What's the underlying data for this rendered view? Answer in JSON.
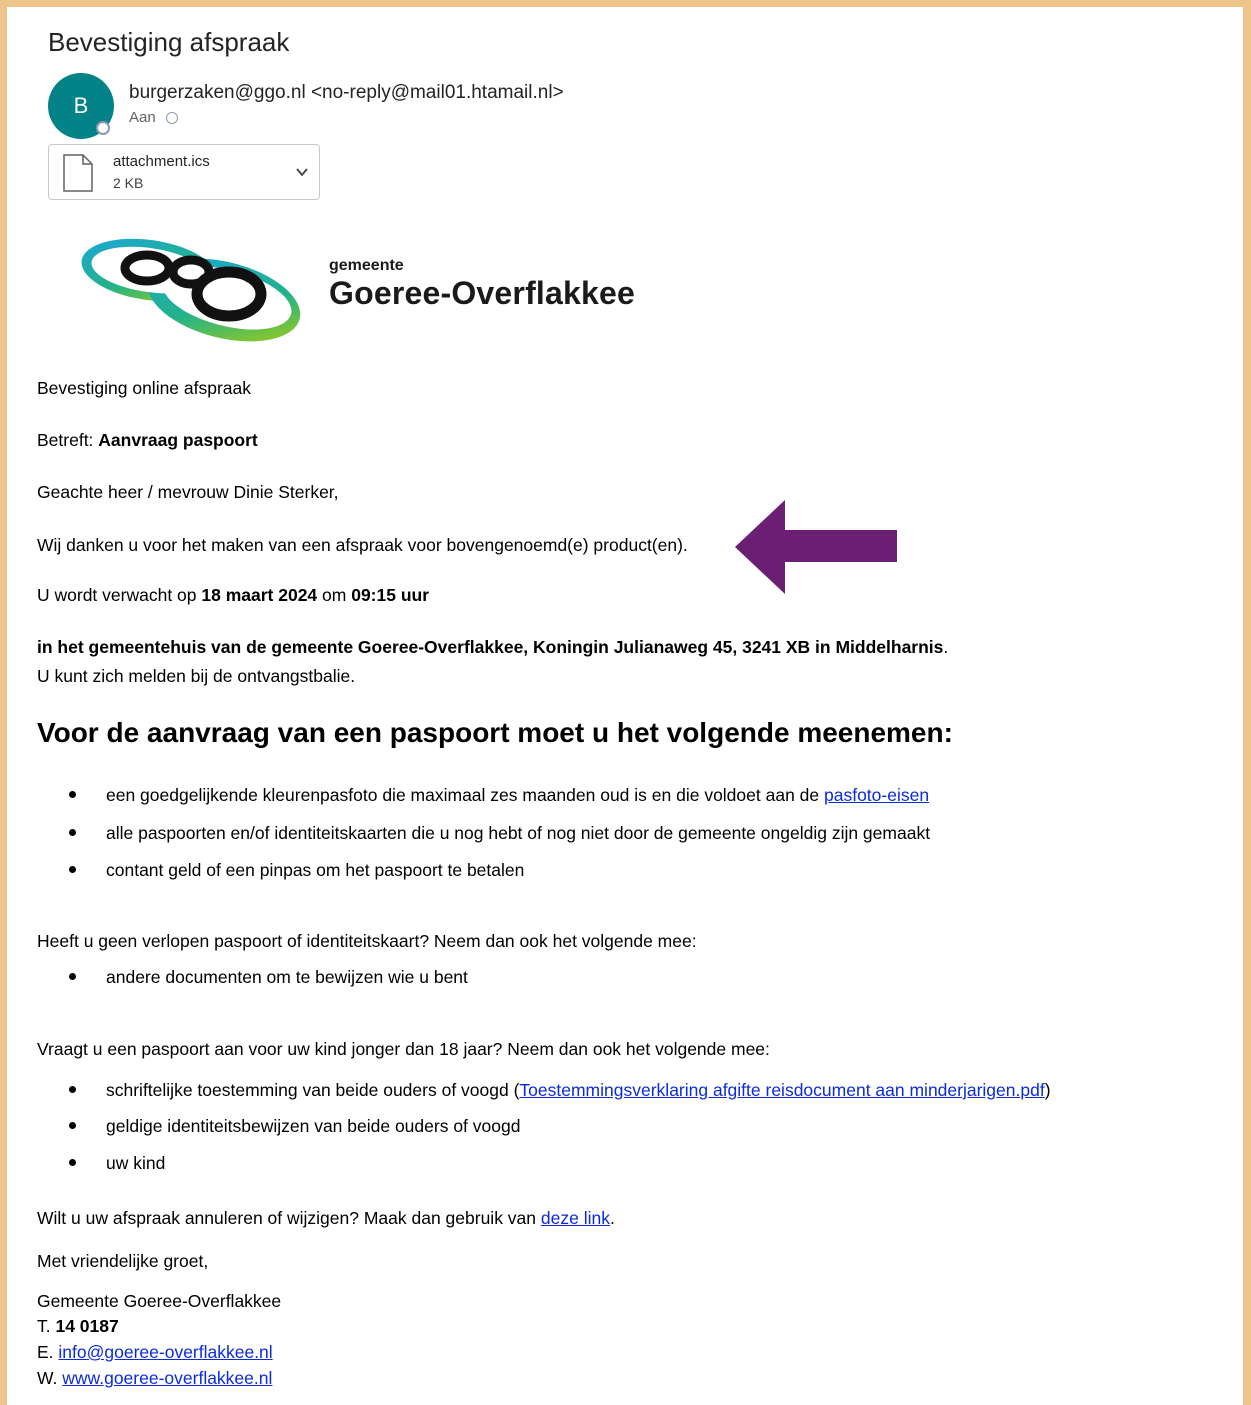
{
  "email": {
    "subject": "Bevestiging afspraak",
    "avatar_initial": "B",
    "sender": "burgerzaken@ggo.nl <no-reply@mail01.htamail.nl>",
    "to_label": "Aan",
    "attachment": {
      "name": "attachment.ics",
      "size": "2 KB"
    }
  },
  "logo": {
    "small": "gemeente",
    "big": "Goeree-Overflakkee"
  },
  "content": {
    "confirmation": "Bevestiging online afspraak",
    "betreft_label": "Betreft: ",
    "betreft_value": "Aanvraag paspoort",
    "greeting": "Geachte heer / mevrouw Dinie Sterker,",
    "thanks": "Wij danken u voor het maken van een afspraak voor bovengenoemd(e) product(en).",
    "expected_prefix": "U wordt verwacht op ",
    "date": "18 maart 2024",
    "expected_mid": " om ",
    "time": "09:15 uur",
    "location_bold": "in het gemeentehuis van de gemeente Goeree-Overflakkee, Koningin Julianaweg 45, 3241 XB in Middelharnis",
    "location_end": ".",
    "report": "U kunt zich melden bij de ontvangstbalie.",
    "heading": "Voor de aanvraag van een paspoort moet u het volgende meenemen:",
    "bring": {
      "item1_text": "een goedgelijkende kleurenpasfoto die maximaal zes maanden oud is en die voldoet aan de ",
      "item1_link": "pasfoto-eisen",
      "item2": "alle paspoorten en/of identiteitskaarten die u nog hebt of nog niet door de gemeente ongeldig zijn gemaakt",
      "item3": "contant geld of een pinpas om het paspoort te betalen"
    },
    "no_passport_intro": "Heeft u geen verlopen paspoort of identiteitskaart? Neem dan ook het volgende mee:",
    "no_passport_item": "andere documenten om te bewijzen wie u bent",
    "child_intro": "Vraagt u een paspoort aan voor uw kind jonger dan 18 jaar? Neem dan ook het volgende mee:",
    "child": {
      "item1_text": "schriftelijke toestemming van beide ouders of voogd (",
      "item1_link": "Toestemmingsverklaring afgifte reisdocument aan minderjarigen.pdf",
      "item1_end": ")",
      "item2": "geldige identiteitsbewijzen van beide ouders of voogd",
      "item3": "uw kind"
    },
    "cancel_text": "Wilt u uw afspraak annuleren of wijzigen? Maak dan gebruik van ",
    "cancel_link": "deze link",
    "cancel_end": ".",
    "closing": "Met vriendelijke groet,",
    "org": "Gemeente Goeree-Overflakkee",
    "phone_label": "T. ",
    "phone": "14 0187",
    "email_label": "E. ",
    "email_link": "info@goeree-overflakkee.nl",
    "web_label": "W. ",
    "web_link": "www.goeree-overflakkee.nl"
  },
  "colors": {
    "avatar": "#038387",
    "link": "#0b2bd9",
    "arrow": "#6b1f73",
    "frame": "#edc48a"
  }
}
